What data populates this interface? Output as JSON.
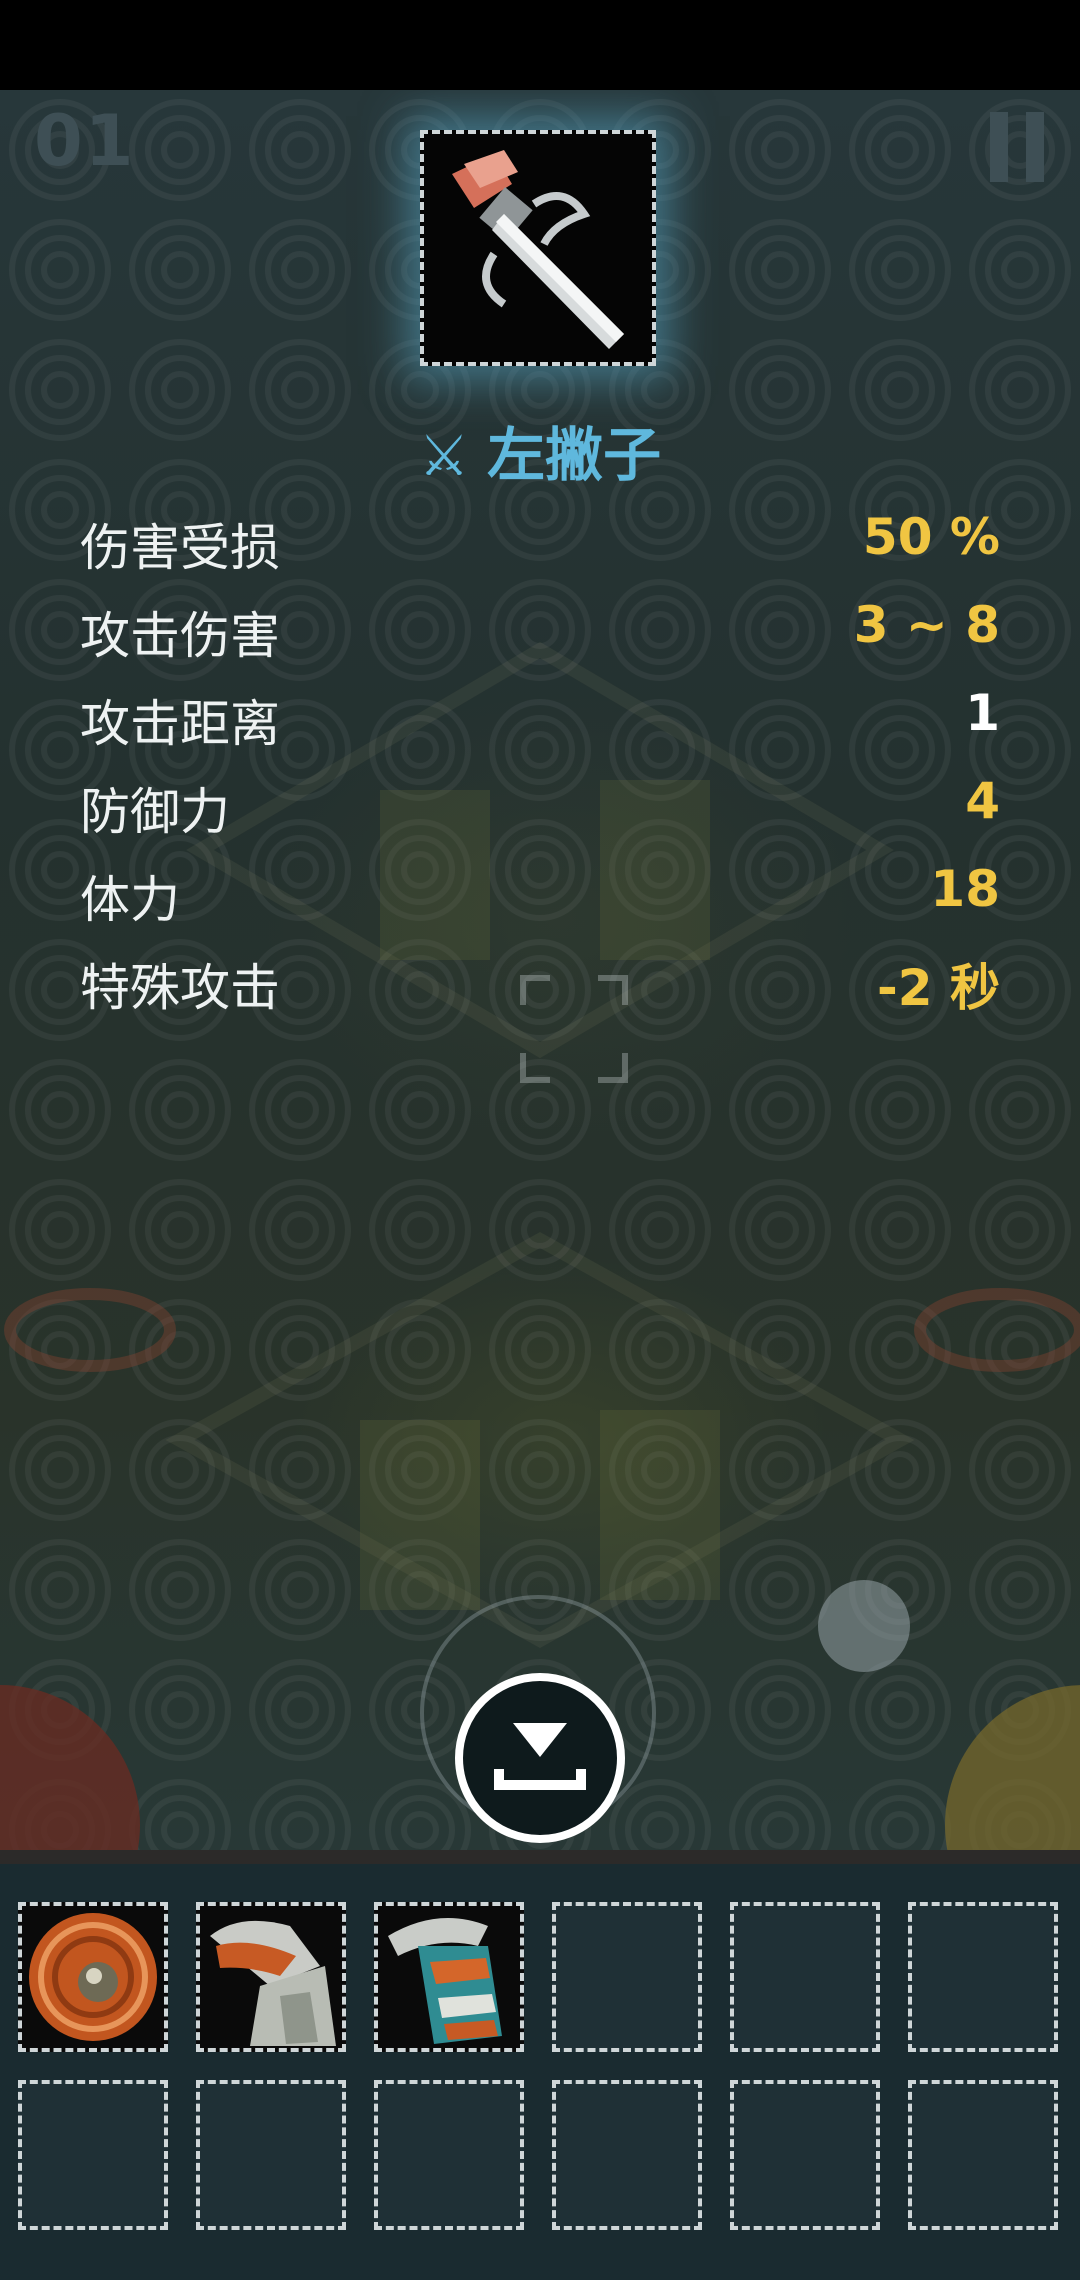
{
  "hud": {
    "level_number": "01"
  },
  "item": {
    "type_icon": "crossed-swords-icon",
    "name": "左撇子",
    "image": "pixel-art-ornate-dagger"
  },
  "stats": [
    {
      "label": "伤害受损",
      "value": "50 %"
    },
    {
      "label": "攻击伤害",
      "value": "3 ~ 8"
    },
    {
      "label": "攻击距离",
      "value": "1"
    },
    {
      "label": "防御力",
      "value": "4"
    },
    {
      "label": "体力",
      "value": "18"
    },
    {
      "label": "特殊攻击",
      "value": "-2 秒"
    }
  ],
  "drop_button": {
    "icon": "drop-item-icon"
  },
  "inventory": {
    "slots": [
      {
        "item": "round-shield"
      },
      {
        "item": "cloth-armor"
      },
      {
        "item": "decorated-gauntlet"
      },
      {
        "item": ""
      },
      {
        "item": ""
      },
      {
        "item": ""
      },
      {
        "item": ""
      },
      {
        "item": ""
      },
      {
        "item": ""
      },
      {
        "item": ""
      },
      {
        "item": ""
      },
      {
        "item": ""
      }
    ]
  },
  "colors": {
    "accent_blue": "#5fb8dd",
    "stat_yellow": "#f0c542",
    "panel_bg": "#1a2b30"
  }
}
